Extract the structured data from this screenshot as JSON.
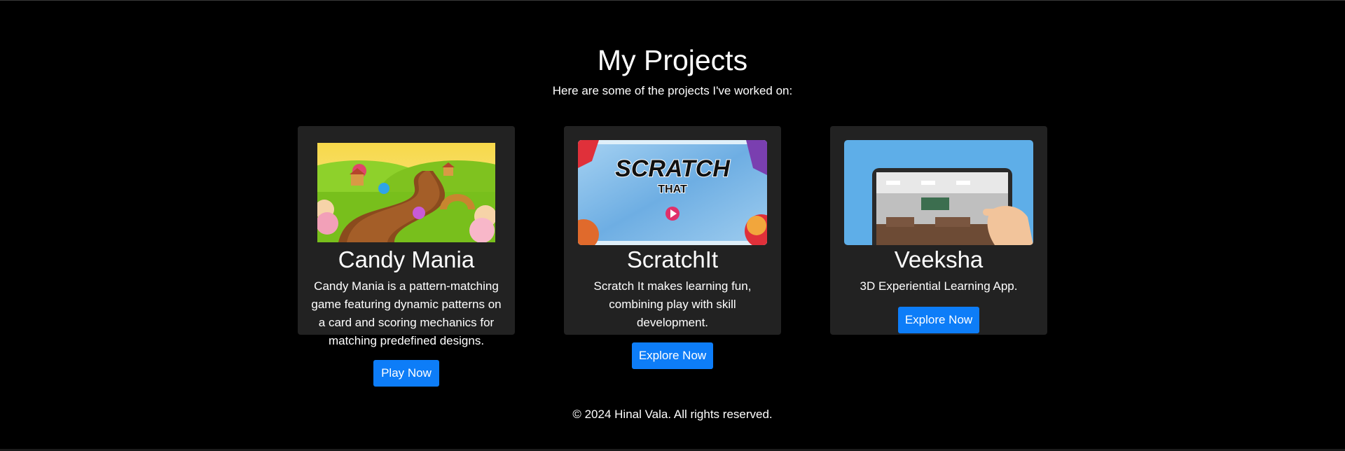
{
  "header": {
    "title": "My Projects",
    "subtitle": "Here are some of the projects I've worked on:"
  },
  "projects": [
    {
      "title": "Candy Mania",
      "description": "Candy Mania is a pattern-matching game featuring dynamic patterns on a card and scoring mechanics for matching predefined designs.",
      "button_label": "Play Now"
    },
    {
      "title": "ScratchIt",
      "description": "Scratch It makes learning fun, combining play with skill development.",
      "button_label": "Explore Now",
      "image_text_top": "SCRATCH",
      "image_text_bottom": "THAT"
    },
    {
      "title": "Veeksha",
      "description": "3D Experiential Learning App.",
      "button_label": "Explore Now"
    }
  ],
  "footer": {
    "copyright": "© 2024 Hinal Vala. All rights reserved."
  },
  "colors": {
    "background": "#000000",
    "card": "#222222",
    "button": "#0d7df8"
  }
}
